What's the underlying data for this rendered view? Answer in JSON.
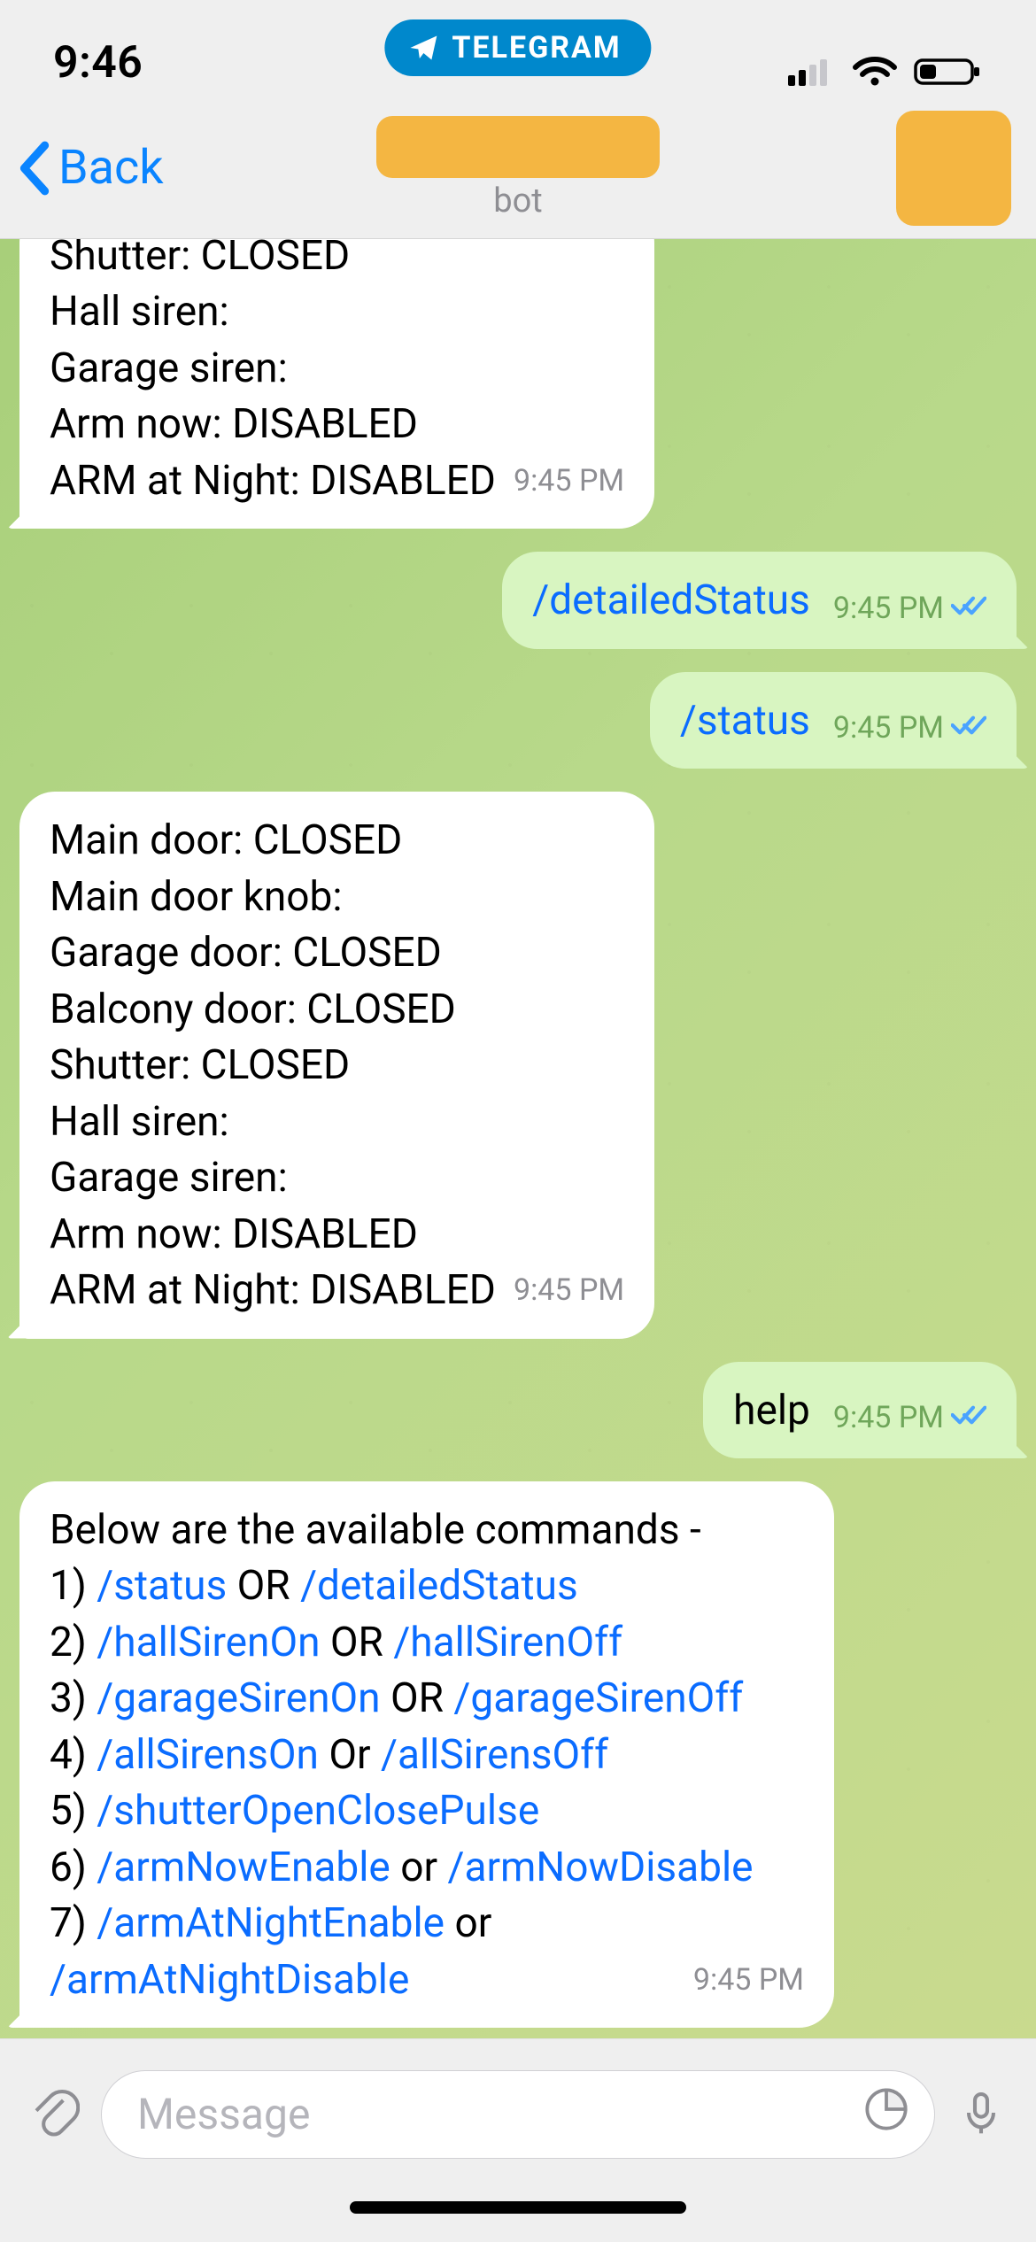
{
  "status_bar": {
    "time": "9:46",
    "pill_label": "TELEGRAM"
  },
  "nav": {
    "back_label": "Back",
    "subtitle": "bot"
  },
  "messages": {
    "m0": {
      "lines": [
        "Shutter: CLOSED",
        "Hall siren:",
        "Garage siren:",
        "Arm now: DISABLED",
        "ARM at Night: DISABLED"
      ],
      "time": "9:45 PM"
    },
    "m1": {
      "text": "/detailedStatus",
      "time": "9:45 PM"
    },
    "m2": {
      "text": "/status",
      "time": "9:45 PM"
    },
    "m3": {
      "lines": [
        "Main door: CLOSED",
        "Main door knob:",
        "Garage door:  CLOSED",
        "Balcony door: CLOSED",
        "Shutter: CLOSED",
        "Hall siren:",
        "Garage siren:",
        "Arm now: DISABLED",
        "ARM at Night: DISABLED"
      ],
      "time": "9:45 PM"
    },
    "m4": {
      "text": "help",
      "time": "9:45 PM"
    },
    "m5": {
      "intro": "Below are the available commands -",
      "rows": [
        {
          "n": "1) ",
          "a": "/status",
          "sep": " OR ",
          "b": "/detailedStatus"
        },
        {
          "n": "2) ",
          "a": "/hallSirenOn",
          "sep": " OR ",
          "b": "/hallSirenOff"
        },
        {
          "n": "3) ",
          "a": "/garageSirenOn",
          "sep": " OR ",
          "b": "/garageSirenOff"
        },
        {
          "n": "4) ",
          "a": "/allSirensOn",
          "sep": " Or ",
          "b": "/allSirensOff"
        },
        {
          "n": "5) ",
          "a": "/shutterOpenClosePulse",
          "sep": "",
          "b": ""
        },
        {
          "n": "6) ",
          "a": "/armNowEnable",
          "sep": " or ",
          "b": "/armNowDisable"
        },
        {
          "n": "7) ",
          "a": "/armAtNightEnable",
          "sep": " or ",
          "b": "/armAtNightDisable"
        }
      ],
      "time": "9:45 PM"
    }
  },
  "composer": {
    "placeholder": "Message"
  }
}
